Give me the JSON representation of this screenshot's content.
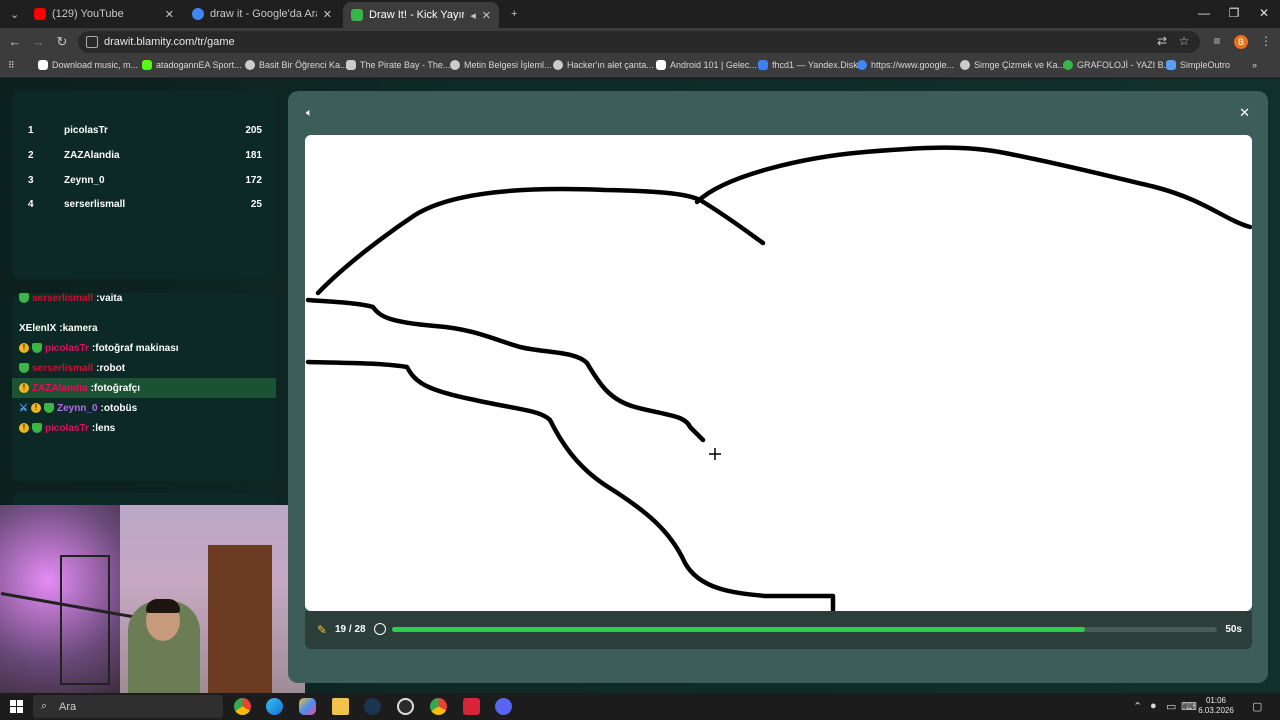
{
  "browser": {
    "tabs": [
      {
        "title": "(129) YouTube",
        "favicon_color": "#ff0000"
      },
      {
        "title": "draw it - Google'da Ara",
        "favicon_color": "#4285f4"
      },
      {
        "title": "Draw It! - Kick Yayınları İçin",
        "favicon_color": "#3ab54a"
      }
    ],
    "new_tab_icon": "plus-icon",
    "url": "drawit.blamity.com/tr/game",
    "profile_initial": "B",
    "bookmarks": [
      {
        "label": "Download music, m...",
        "color": "#ffffff"
      },
      {
        "label": "atadogannEA Sport...",
        "color": "#53fc18"
      },
      {
        "label": "Basit Bir Öğrenci Ka...",
        "color": "#cccccc"
      },
      {
        "label": "The Pirate Bay - The...",
        "color": "#cccccc"
      },
      {
        "label": "Metin Belgesi İşleml...",
        "color": "#cccccc"
      },
      {
        "label": "Hacker'ın alet çanta...",
        "color": "#cccccc"
      },
      {
        "label": "Android 101 | Gelec...",
        "color": "#ffffff"
      },
      {
        "label": "fhcd1 — Yandex.Disk",
        "color": "#3d7ff2"
      },
      {
        "label": "https://www.google...",
        "color": "#4285f4"
      },
      {
        "label": "Simge Çizmek ve Ka...",
        "color": "#cccccc"
      },
      {
        "label": "GRAFOLOJİ - YAZI B...",
        "color": "#3ab54a"
      },
      {
        "label": "SimpleOutro",
        "color": "#5aa0f0"
      }
    ]
  },
  "scoreboard": [
    {
      "rank": "1",
      "name": "picolasTr",
      "score": "205"
    },
    {
      "rank": "2",
      "name": "ZAZAlandia",
      "score": "181"
    },
    {
      "rank": "3",
      "name": "Zeynn_0",
      "score": "172"
    },
    {
      "rank": "4",
      "name": "serserlismall",
      "score": "25"
    }
  ],
  "chat": [
    {
      "user": "serserlismall",
      "message": ":vaita",
      "user_color": "#c8102e",
      "badges": [
        "shield"
      ],
      "highlight": false
    },
    {
      "user": "XElenIX",
      "message": ":kamera",
      "user_color": "#ffffff",
      "badges": [],
      "highlight": false
    },
    {
      "user": "picolasTr",
      "message": ":fotoğraf makinası",
      "user_color": "#e0105a",
      "badges": [
        "warn",
        "shield"
      ],
      "highlight": false
    },
    {
      "user": "serserlismall",
      "message": ":robot",
      "user_color": "#c8102e",
      "badges": [
        "shield"
      ],
      "highlight": false
    },
    {
      "user": "ZAZAlandia",
      "message": ":fotoğrafçı",
      "user_color": "#e0105a",
      "badges": [
        "warn"
      ],
      "highlight": true
    },
    {
      "user": "Zeynn_0",
      "message": ":otobüs",
      "user_color": "#b768f5",
      "badges": [
        "sword",
        "warn",
        "shield"
      ],
      "highlight": false
    },
    {
      "user": "picolasTr",
      "message": ":lens",
      "user_color": "#e0105a",
      "badges": [
        "warn",
        "shield"
      ],
      "highlight": false
    }
  ],
  "game": {
    "sound_icon": "speaker-icon",
    "close_icon": "close-icon",
    "round": "19 / 28",
    "timer": "50s",
    "time_remaining_fraction": 0.84,
    "progress_color": "#2dcc4d"
  },
  "taskbar": {
    "search_placeholder": "Ara",
    "time": "01:06",
    "date": "6.03.2026",
    "apps": [
      "chrome-icon",
      "edge-icon",
      "copilot-icon",
      "explorer-icon",
      "steam-icon",
      "obs-icon",
      "chrome-icon",
      "screenpresso-icon",
      "discord-icon"
    ]
  }
}
